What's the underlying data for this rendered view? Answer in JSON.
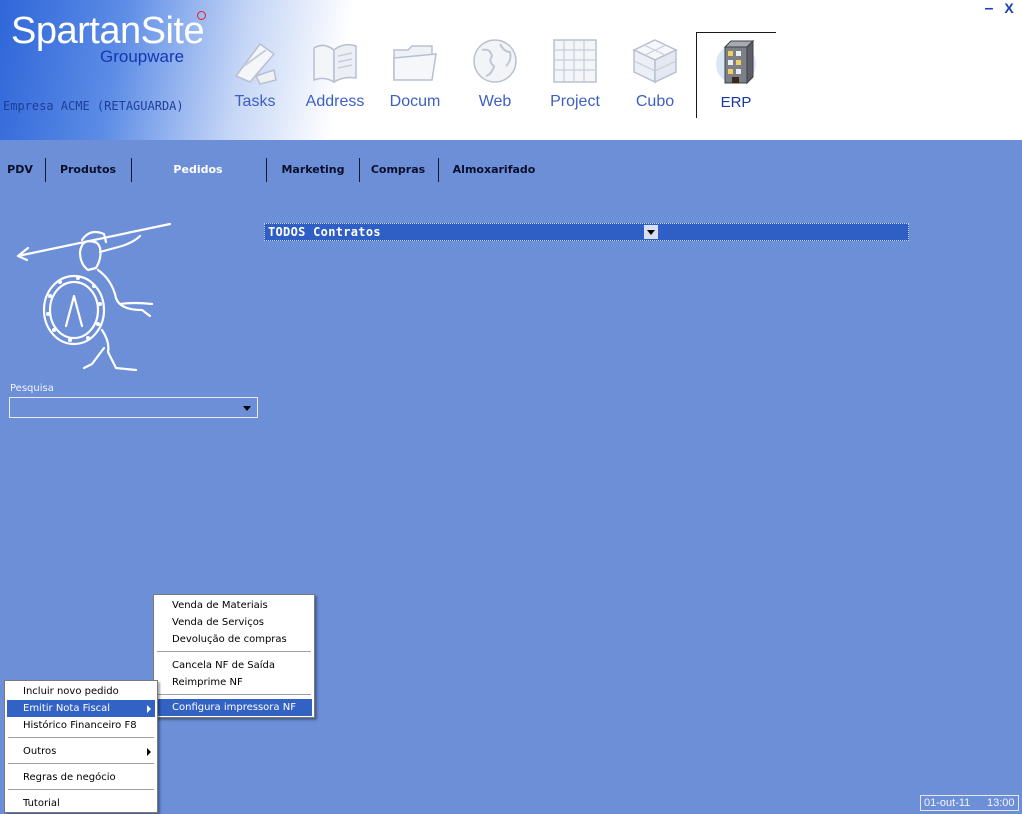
{
  "header": {
    "brand": "SpartanSite",
    "brand_sub": "Groupware",
    "company": "Empresa ACME (RETAGUARDA)",
    "window_min": "–",
    "window_close": "X"
  },
  "apps": [
    {
      "label": "Tasks",
      "icon": "tasks-icon"
    },
    {
      "label": "Address",
      "icon": "address-book-icon"
    },
    {
      "label": "Docum",
      "icon": "documents-icon"
    },
    {
      "label": "Web",
      "icon": "globe-icon"
    },
    {
      "label": "Project",
      "icon": "project-icon"
    },
    {
      "label": "Cubo",
      "icon": "cube-icon"
    },
    {
      "label": "ERP",
      "icon": "building-icon",
      "active": true
    }
  ],
  "nav": {
    "tabs": [
      "PDV",
      "Produtos",
      "Pedidos",
      "Marketing",
      "Compras",
      "Almoxarifado"
    ],
    "active": "Pedidos"
  },
  "contracts": {
    "selected": "TODOS Contratos"
  },
  "search": {
    "label": "Pesquisa",
    "value": ""
  },
  "context_menu": {
    "items": [
      "Incluir novo pedido",
      "Emitir Nota Fiscal",
      "Histórico Financeiro   F8",
      "Outros",
      "Regras de negócio",
      "Tutorial"
    ],
    "selected": "Emitir Nota Fiscal"
  },
  "submenu": {
    "items": [
      "Venda de Materiais",
      "Venda de Serviços",
      "Devolução de compras",
      "Cancela NF de Saída",
      "Reimprime NF",
      "Configura impressora NF"
    ],
    "selected": "Configura impressora NF"
  },
  "status": {
    "date": "01-out-11",
    "time": "13:00"
  },
  "colors": {
    "background": "#6c8fd8",
    "menu_highlight": "#3162c4",
    "dropdown": "#2f5ec4"
  }
}
